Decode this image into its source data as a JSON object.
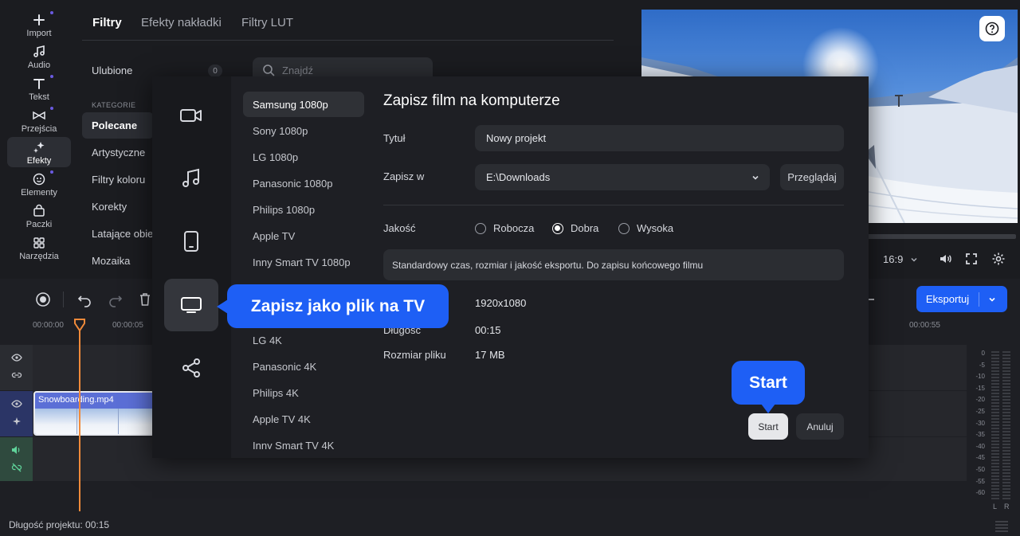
{
  "rail": {
    "items": [
      {
        "label": "Import",
        "icon": "plus-icon",
        "dot": true
      },
      {
        "label": "Audio",
        "icon": "music-note-icon",
        "dot": false
      },
      {
        "label": "Tekst",
        "icon": "text-icon",
        "dot": true
      },
      {
        "label": "Przejścia",
        "icon": "transitions-icon",
        "dot": true
      },
      {
        "label": "Efekty",
        "icon": "sparkle-icon",
        "dot": false,
        "active": true
      },
      {
        "label": "Elementy",
        "icon": "smiley-icon",
        "dot": true
      },
      {
        "label": "Paczki",
        "icon": "bag-icon",
        "dot": false
      },
      {
        "label": "Narzędzia",
        "icon": "grid-icon",
        "dot": false
      }
    ]
  },
  "effects": {
    "tabs": [
      "Filtry",
      "Efekty nakładki",
      "Filtry LUT"
    ],
    "favorites_label": "Ulubione",
    "favorites_count": "0",
    "search_placeholder": "Znajdź",
    "categories_heading": "KATEGORIE",
    "categories": [
      "Polecane",
      "Artystyczne",
      "Filtry koloru",
      "Korekty",
      "Latające obiekty",
      "Mozaika"
    ]
  },
  "player": {
    "aspect": "16:9"
  },
  "timeline": {
    "times": [
      "00:00:00",
      "00:00:05",
      "00:00:55"
    ],
    "clip_name": "Snowboarding.mp4",
    "export_label": "Eksportuj",
    "project_length": "Długość projektu: 00:15",
    "meter_scale": [
      "0",
      "-5",
      "-10",
      "-15",
      "-20",
      "-25",
      "-30",
      "-35",
      "-40",
      "-45",
      "-50",
      "-55",
      "-60"
    ],
    "meter_channels": [
      "L",
      "R"
    ]
  },
  "modal": {
    "devices": [
      "Samsung 1080p",
      "Sony 1080p",
      "LG 1080p",
      "Panasonic 1080p",
      "Philips 1080p",
      "Apple TV",
      "Inny Smart TV 1080p",
      "LG 4K",
      "Panasonic 4K",
      "Philips 4K",
      "Apple TV 4K",
      "Inny Smart TV 4K"
    ],
    "title": "Zapisz film na komputerze",
    "title_label": "Tytuł",
    "title_value": "Nowy projekt",
    "save_in_label": "Zapisz w",
    "save_in_value": "E:\\Downloads",
    "browse_label": "Przeglądaj",
    "quality_label": "Jakość",
    "quality_options": [
      "Robocza",
      "Dobra",
      "Wysoka"
    ],
    "quality_selected": "Dobra",
    "quality_desc": "Standardowy czas, rozmiar i jakość eksportu. Do zapisu końcowego filmu",
    "resolution_value": "1920x1080",
    "duration_label": "Długość",
    "duration_value": "00:15",
    "filesize_label": "Rozmiar pliku",
    "filesize_value": "17 MB",
    "start_label": "Start",
    "cancel_label": "Anuluj"
  },
  "callouts": {
    "tv": "Zapisz jako plik na TV",
    "start": "Start"
  },
  "colors": {
    "accent": "#1e5ff5",
    "clip": "#5b6fd6",
    "playhead": "#f08a3a",
    "audio_track": "#2f4a3e"
  }
}
